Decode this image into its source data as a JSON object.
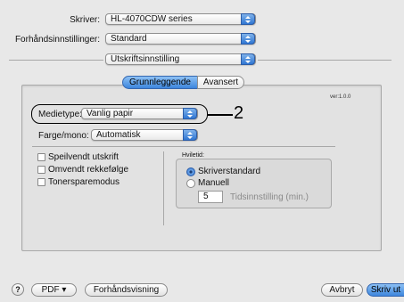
{
  "printer": {
    "label": "Skriver:",
    "value": "HL-4070CDW series"
  },
  "presets": {
    "label": "Forhåndsinnstillinger:",
    "value": "Standard"
  },
  "section": {
    "value": "Utskriftsinnstilling"
  },
  "tabs": [
    {
      "label": "Grunnleggende",
      "selected": true
    },
    {
      "label": "Avansert",
      "selected": false
    }
  ],
  "version": "ver:1.0.0",
  "media_type": {
    "label": "Medietype:",
    "value": "Vanlig papir"
  },
  "callout": "2",
  "color_mono": {
    "label": "Farge/mono:",
    "value": "Automatisk"
  },
  "checkboxes": [
    {
      "label": "Speilvendt utskrift",
      "checked": false
    },
    {
      "label": "Omvendt rekkefølge",
      "checked": false
    },
    {
      "label": "Tonersparemodus",
      "checked": false
    }
  ],
  "sleep": {
    "title": "Hviletid:",
    "options": [
      {
        "label": "Skriverstandard",
        "selected": true
      },
      {
        "label": "Manuell",
        "selected": false
      }
    ],
    "value": "5",
    "time_label": "Tidsinnstilling (min.)"
  },
  "footer": {
    "help": "?",
    "pdf_label": "PDF ▾",
    "preview_label": "Forhåndsvisning",
    "cancel_label": "Avbryt",
    "print_label": "Skriv ut"
  },
  "colors": {
    "accent": "#3d86dd",
    "background": "#e8e8e8"
  }
}
